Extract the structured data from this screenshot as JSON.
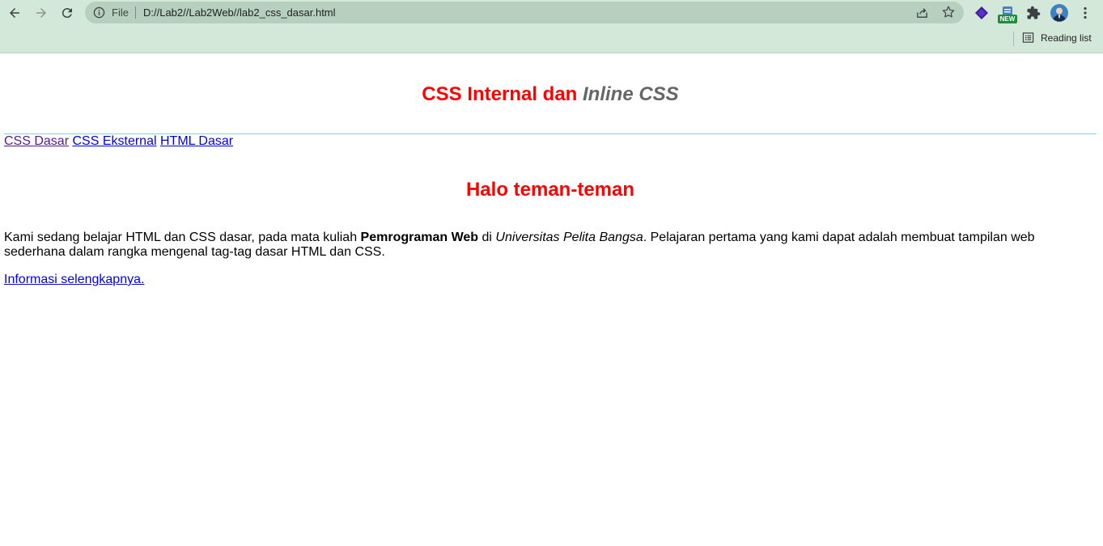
{
  "browser": {
    "file_label": "File",
    "url": "D://Lab2//Lab2Web//lab2_css_dasar.html",
    "new_badge": "NEW",
    "reading_list": "Reading list"
  },
  "page": {
    "title_part1": "CSS Internal dan ",
    "title_em": "Inline CSS",
    "nav_links": [
      "CSS Dasar",
      "CSS Eksternal",
      "HTML Dasar"
    ],
    "greeting": "Halo teman-teman",
    "para": {
      "t1": "Kami sedang belajar HTML dan CSS dasar, pada mata kuliah ",
      "bold": "Pemrograman Web",
      "t2": " di ",
      "italic": "Universitas Pelita Bangsa",
      "t3": ". Pelajaran pertama yang kami dapat adalah membuat tampilan web sederhana dalam rangka mengenal tag-tag dasar HTML dan CSS."
    },
    "more_link": "Informasi selengkapnya."
  },
  "colors": {
    "chrome_bg": "#d3e8d8",
    "heading_red": "#ff0000",
    "heading_gray": "#666666",
    "link_blue": "#0000ee",
    "link_visited": "#551a8b",
    "hr_blue": "#87ceeb"
  }
}
